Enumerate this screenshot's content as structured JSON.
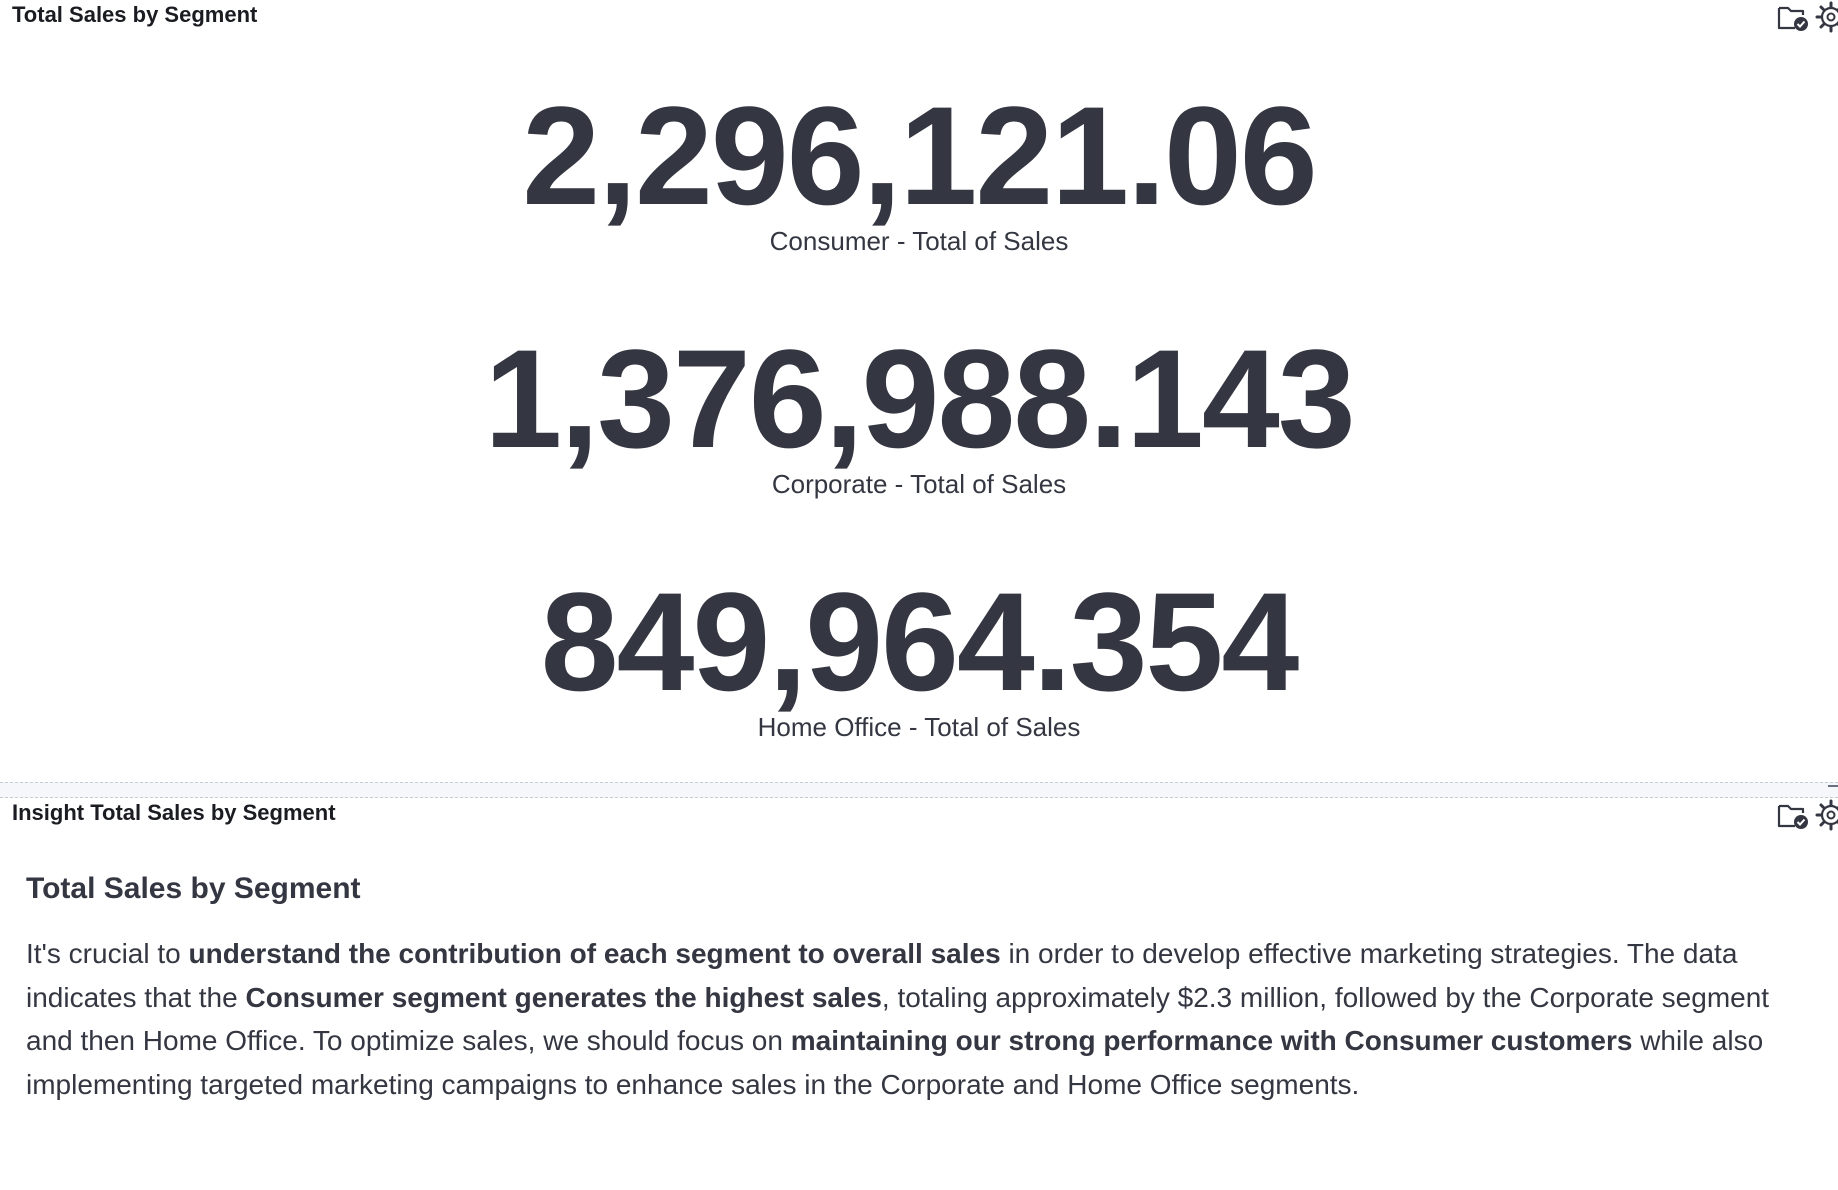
{
  "top_panel": {
    "title": "Total Sales by Segment",
    "metrics": [
      {
        "value": "2,296,121.06",
        "label": "Consumer - Total of Sales"
      },
      {
        "value": "1,376,988.143",
        "label": "Corporate - Total of Sales"
      },
      {
        "value": "849,964.354",
        "label": "Home Office - Total of Sales"
      }
    ]
  },
  "bottom_panel": {
    "title": "Insight Total Sales by Segment",
    "heading": "Total Sales by Segment",
    "paragraph": [
      {
        "text": "It's crucial to ",
        "bold": false
      },
      {
        "text": "understand the contribution of each segment to overall sales",
        "bold": true
      },
      {
        "text": " in order to develop effective marketing strategies. The data indicates that the ",
        "bold": false
      },
      {
        "text": "Consumer segment generates the highest sales",
        "bold": true
      },
      {
        "text": ", totaling approximately $2.3 million, followed by the Corporate segment and then Home Office. To optimize sales, we should focus on ",
        "bold": false
      },
      {
        "text": "maintaining our strong performance with Consumer customers",
        "bold": true
      },
      {
        "text": " while also implementing targeted marketing campaigns to enhance sales in the Corporate and Home Office segments.",
        "bold": false
      }
    ]
  },
  "icons": {
    "panel_options": "folder-check-icon",
    "panel_settings": "gear-icon"
  },
  "colors": {
    "text": "#343741",
    "title": "#1a1c21",
    "badge": "#343741"
  }
}
